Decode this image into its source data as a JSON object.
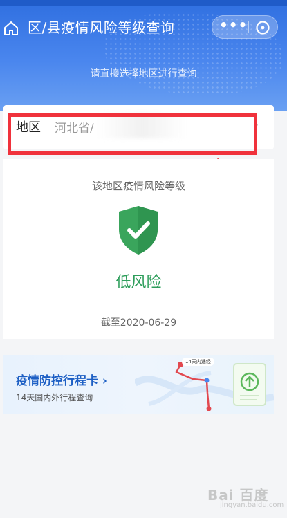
{
  "header": {
    "title": "区/县疫情风险等级查询",
    "subtitle": "请直接选择地区进行查询",
    "more_label": "•••"
  },
  "region": {
    "label": "地区",
    "value": "河北省/",
    "chevron": "›"
  },
  "risk": {
    "heading": "该地区疫情风险等级",
    "level": "低风险",
    "date": "截至2020-06-29"
  },
  "travel_card": {
    "title": "疫情防控行程卡 ›",
    "subtitle": "14天国内外行程查询",
    "map_tag": "14天内途经"
  },
  "watermark": {
    "brand": "Bai 百度",
    "sub": "jingyan.baidu.com"
  },
  "colors": {
    "header_blue": "#2f6fe0",
    "highlight_red": "#f0323c",
    "shield_green": "#3aa55c",
    "risk_green": "#2e9e5b",
    "travel_title_blue": "#1d5fc4"
  },
  "icons": {
    "home": "home-icon",
    "more": "more-icon",
    "close": "close-circle-icon",
    "shield": "shield-check-icon",
    "arrow": "red-arrow-icon",
    "upload": "upload-card-icon"
  }
}
